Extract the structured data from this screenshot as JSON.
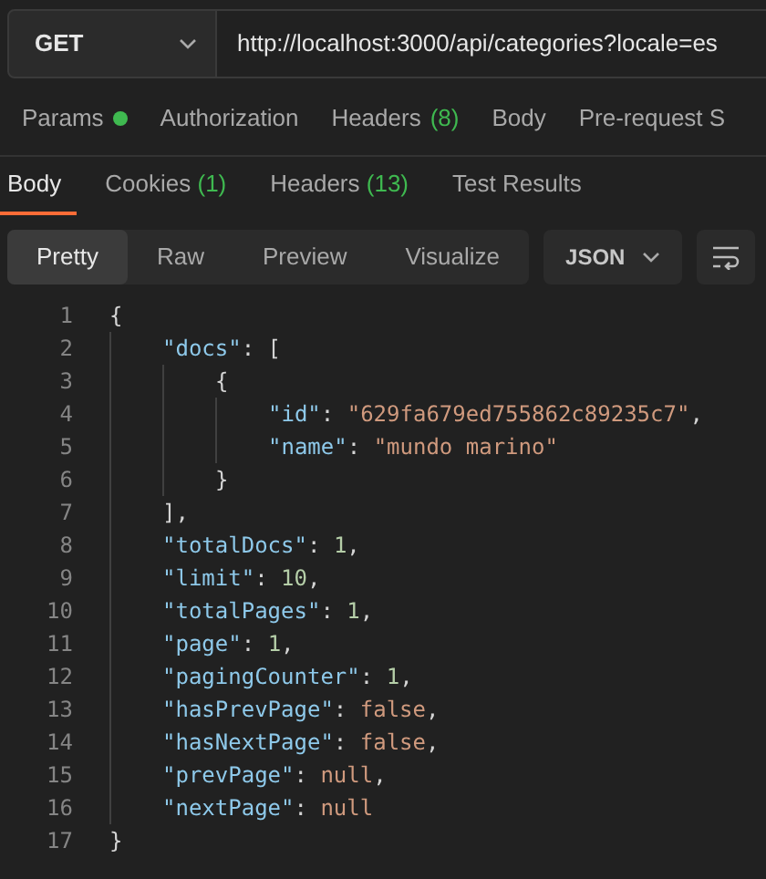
{
  "request": {
    "method": "GET",
    "url": "http://localhost:3000/api/categories?locale=es"
  },
  "request_tabs": [
    {
      "label": "Params",
      "dot": true
    },
    {
      "label": "Authorization"
    },
    {
      "label": "Headers",
      "count": "(8)"
    },
    {
      "label": "Body"
    },
    {
      "label": "Pre-request S"
    }
  ],
  "response_tabs": [
    {
      "label": "Body",
      "selected": true
    },
    {
      "label": "Cookies",
      "count": "(1)",
      "selected": false
    },
    {
      "label": "Headers",
      "count": "(13)",
      "selected": false
    },
    {
      "label": "Test Results",
      "selected": false
    }
  ],
  "view_modes": [
    {
      "label": "Pretty",
      "selected": true
    },
    {
      "label": "Raw",
      "selected": false
    },
    {
      "label": "Preview",
      "selected": false
    },
    {
      "label": "Visualize",
      "selected": false
    }
  ],
  "format": "JSON",
  "code_lines": [
    {
      "number": "1",
      "tokens": [
        {
          "kind": "punct",
          "text": "{"
        }
      ],
      "children": [
        {
          "number": "2",
          "tokens": [
            {
              "kind": "key",
              "text": "\"docs\""
            },
            {
              "kind": "punct",
              "text": ": ["
            }
          ],
          "children": [
            {
              "number": "3",
              "tokens": [
                {
                  "kind": "punct",
                  "text": "{"
                }
              ],
              "children": [
                {
                  "number": "4",
                  "tokens": [
                    {
                      "kind": "key",
                      "text": "\"id\""
                    },
                    {
                      "kind": "punct",
                      "text": ": "
                    },
                    {
                      "kind": "string",
                      "text": "\"629fa679ed755862c89235c7\""
                    },
                    {
                      "kind": "punct",
                      "text": ","
                    }
                  ]
                },
                {
                  "number": "5",
                  "tokens": [
                    {
                      "kind": "key",
                      "text": "\"name\""
                    },
                    {
                      "kind": "punct",
                      "text": ": "
                    },
                    {
                      "kind": "string",
                      "text": "\"mundo marino\""
                    }
                  ]
                }
              ]
            },
            {
              "number": "6",
              "tokens": [
                {
                  "kind": "punct",
                  "text": "}"
                }
              ]
            }
          ]
        },
        {
          "number": "7",
          "tokens": [
            {
              "kind": "punct",
              "text": "],"
            }
          ]
        },
        {
          "number": "8",
          "tokens": [
            {
              "kind": "key",
              "text": "\"totalDocs\""
            },
            {
              "kind": "punct",
              "text": ": "
            },
            {
              "kind": "number",
              "text": "1"
            },
            {
              "kind": "punct",
              "text": ","
            }
          ]
        },
        {
          "number": "9",
          "tokens": [
            {
              "kind": "key",
              "text": "\"limit\""
            },
            {
              "kind": "punct",
              "text": ": "
            },
            {
              "kind": "number",
              "text": "10"
            },
            {
              "kind": "punct",
              "text": ","
            }
          ]
        },
        {
          "number": "10",
          "tokens": [
            {
              "kind": "key",
              "text": "\"totalPages\""
            },
            {
              "kind": "punct",
              "text": ": "
            },
            {
              "kind": "number",
              "text": "1"
            },
            {
              "kind": "punct",
              "text": ","
            }
          ]
        },
        {
          "number": "11",
          "tokens": [
            {
              "kind": "key",
              "text": "\"page\""
            },
            {
              "kind": "punct",
              "text": ": "
            },
            {
              "kind": "number",
              "text": "1"
            },
            {
              "kind": "punct",
              "text": ","
            }
          ]
        },
        {
          "number": "12",
          "tokens": [
            {
              "kind": "key",
              "text": "\"pagingCounter\""
            },
            {
              "kind": "punct",
              "text": ": "
            },
            {
              "kind": "number",
              "text": "1"
            },
            {
              "kind": "punct",
              "text": ","
            }
          ]
        },
        {
          "number": "13",
          "tokens": [
            {
              "kind": "key",
              "text": "\"hasPrevPage\""
            },
            {
              "kind": "punct",
              "text": ": "
            },
            {
              "kind": "literal",
              "text": "false"
            },
            {
              "kind": "punct",
              "text": ","
            }
          ]
        },
        {
          "number": "14",
          "tokens": [
            {
              "kind": "key",
              "text": "\"hasNextPage\""
            },
            {
              "kind": "punct",
              "text": ": "
            },
            {
              "kind": "literal",
              "text": "false"
            },
            {
              "kind": "punct",
              "text": ","
            }
          ]
        },
        {
          "number": "15",
          "tokens": [
            {
              "kind": "key",
              "text": "\"prevPage\""
            },
            {
              "kind": "punct",
              "text": ": "
            },
            {
              "kind": "literal",
              "text": "null"
            },
            {
              "kind": "punct",
              "text": ","
            }
          ]
        },
        {
          "number": "16",
          "tokens": [
            {
              "kind": "key",
              "text": "\"nextPage\""
            },
            {
              "kind": "punct",
              "text": ": "
            },
            {
              "kind": "literal",
              "text": "null"
            }
          ]
        }
      ]
    },
    {
      "number": "17",
      "tokens": [
        {
          "kind": "punct",
          "text": "}"
        }
      ]
    }
  ]
}
